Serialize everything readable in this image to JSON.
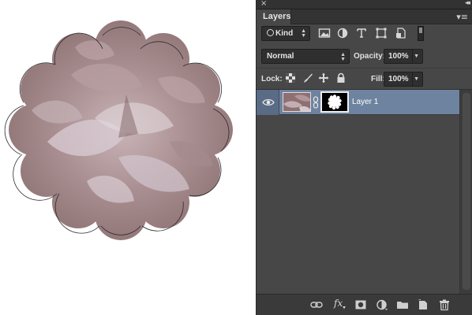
{
  "panel": {
    "close_glyph": "×",
    "collapse_glyph": "◂◂",
    "tab_label": "Layers",
    "menu_glyph": "▾≡"
  },
  "filter": {
    "kind_label": "Kind",
    "icons": [
      "pixel-layer-filter-icon",
      "adjustment-layer-filter-icon",
      "type-layer-filter-icon",
      "shape-layer-filter-icon",
      "smart-object-filter-icon"
    ]
  },
  "blend": {
    "mode": "Normal",
    "opacity_label": "Opacity:",
    "opacity_value": "100%"
  },
  "lock": {
    "label": "Lock:",
    "icons": [
      "lock-transparent-pixels-icon",
      "lock-image-pixels-icon",
      "lock-position-icon",
      "lock-all-icon"
    ],
    "fill_label": "Fill:",
    "fill_value": "100%"
  },
  "layers": [
    {
      "name": "Layer 1",
      "visible": true,
      "selected": true,
      "has_mask": true,
      "linked": true
    }
  ],
  "bottom_bar": {
    "icons": [
      "link-layers-icon",
      "fx-icon",
      "add-mask-icon",
      "adjustment-layer-icon",
      "new-group-icon",
      "new-layer-icon",
      "trash-icon"
    ],
    "fx_label": "fx"
  },
  "colors": {
    "panel_bg": "#474747",
    "selected_row": "#6e839f",
    "canvas_bg": "#ffffff",
    "petal_base": "#9a7f80"
  }
}
